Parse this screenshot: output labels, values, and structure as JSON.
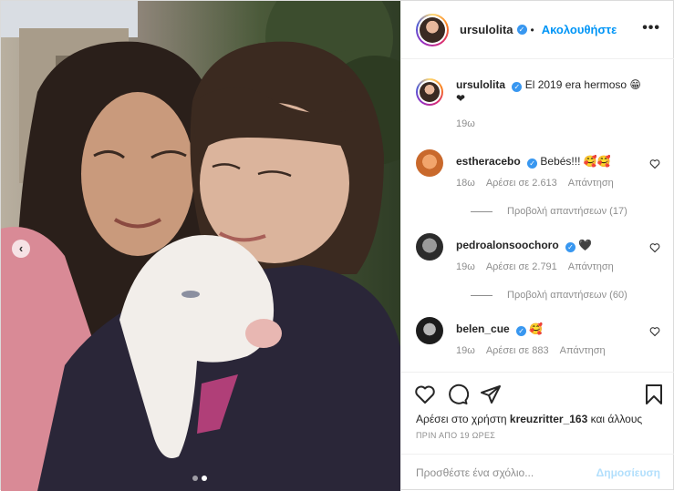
{
  "header": {
    "username": "ursulolita",
    "separator": "•",
    "follow_label": "Ακολουθήστε",
    "more_label": "•••"
  },
  "caption": {
    "username": "ursulolita",
    "text": "El 2019 era hermoso 😁 ❤",
    "time": "19ω"
  },
  "comments": [
    {
      "username": "estheracebo",
      "text": "Bebés!!! 🥰🥰",
      "time": "18ω",
      "likes": "Αρέσει σε 2.613",
      "reply": "Απάντηση",
      "view_replies": "Προβολή απαντήσεων (17)"
    },
    {
      "username": "pedroalonsoochoro",
      "text": "🖤",
      "time": "19ω",
      "likes": "Αρέσει σε 2.791",
      "reply": "Απάντηση",
      "view_replies": "Προβολή απαντήσεων (60)"
    },
    {
      "username": "belen_cue",
      "text": "🥰",
      "time": "19ω",
      "likes": "Αρέσει σε 883",
      "reply": "Απάντηση"
    }
  ],
  "likes_line": {
    "prefix": "Αρέσει στο χρήστη",
    "user": "kreuzritter_163",
    "suffix": "και άλλους"
  },
  "posted": "ΠΡΙΝ ΑΠΟ 19 ΩΡΕΣ",
  "add_comment": {
    "placeholder": "Προσθέστε ένα σχόλιο...",
    "publish_label": "Δημοσίευση"
  },
  "carousel": {
    "prev_glyph": "‹",
    "slides": 2,
    "current": 2
  },
  "icons": [
    "heart-icon",
    "comment-icon",
    "share-icon",
    "bookmark-icon",
    "verified-icon",
    "more-icon",
    "chevron-left-icon"
  ],
  "colors": {
    "link": "#0095f6",
    "verified": "#3897f0",
    "muted": "#8e8e8e",
    "publish_disabled": "#b2dffc"
  }
}
